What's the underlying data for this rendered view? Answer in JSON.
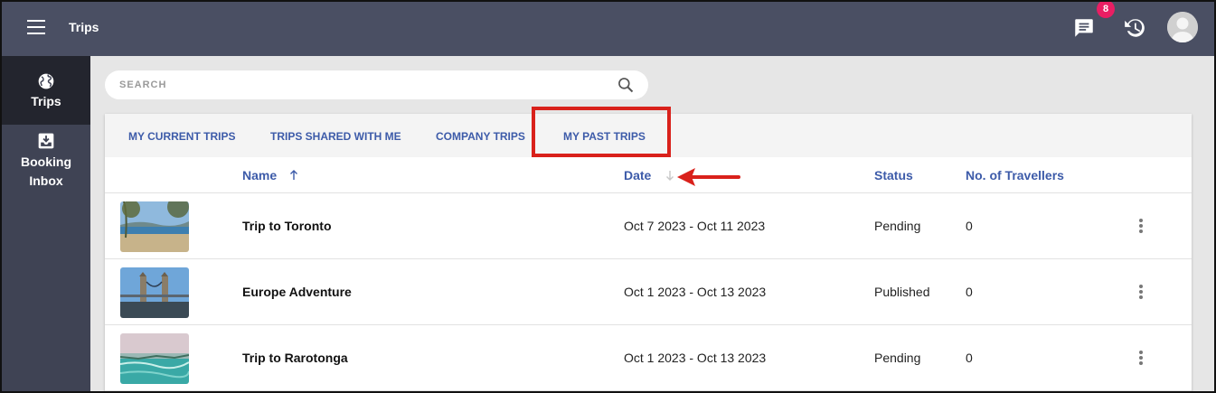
{
  "header": {
    "title": "Trips",
    "notification_count": "8"
  },
  "sidebar": {
    "items": [
      {
        "label": "Trips",
        "icon": "globe-icon"
      },
      {
        "label": "Booking Inbox",
        "icon": "inbox-icon"
      }
    ]
  },
  "search": {
    "placeholder": "SEARCH"
  },
  "tabs": [
    {
      "label": "MY CURRENT TRIPS"
    },
    {
      "label": "TRIPS SHARED WITH ME"
    },
    {
      "label": "COMPANY TRIPS"
    },
    {
      "label": "MY PAST TRIPS"
    }
  ],
  "table": {
    "columns": {
      "name": "Name",
      "date": "Date",
      "status": "Status",
      "travellers": "No. of Travellers"
    },
    "rows": [
      {
        "name": "Trip to Toronto",
        "date": "Oct 7 2023 - Oct 11 2023",
        "status": "Pending",
        "travellers": "0"
      },
      {
        "name": "Europe Adventure",
        "date": "Oct 1 2023 - Oct 13 2023",
        "status": "Published",
        "travellers": "0"
      },
      {
        "name": "Trip to Rarotonga",
        "date": "Oct 1 2023 - Oct 13 2023",
        "status": "Pending",
        "travellers": "0"
      }
    ]
  },
  "colors": {
    "topbar": "#4a4f63",
    "sidebar": "#3f4354",
    "accent": "#3d5ba9",
    "badge": "#e91e63",
    "annotation": "#d9211b"
  }
}
